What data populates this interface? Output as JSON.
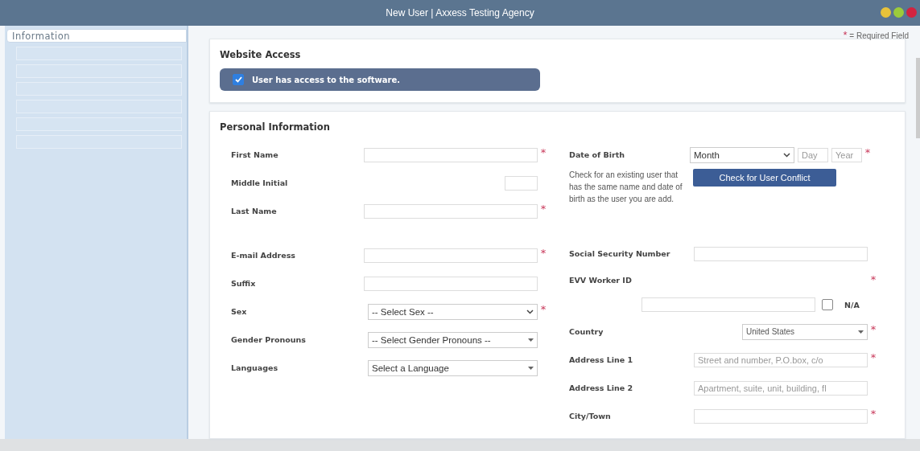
{
  "window": {
    "title": "New User | Axxess Testing Agency"
  },
  "sidebar": {
    "items": [
      {
        "label": "Information",
        "selected": true
      },
      {
        "selected": false
      },
      {
        "selected": false
      },
      {
        "selected": false
      },
      {
        "selected": false
      },
      {
        "selected": false
      },
      {
        "selected": false
      }
    ]
  },
  "required_note": {
    "mark": "*",
    "text": "= Required Field"
  },
  "website_access": {
    "title": "Website Access",
    "checkbox": {
      "label": "User has access to the software.",
      "checked": true
    }
  },
  "personal_information": {
    "title": "Personal Information",
    "left_fields": [
      {
        "kind": "text",
        "label": "First Name",
        "required": true
      },
      {
        "kind": "short",
        "label": "Middle Initial",
        "required": false
      },
      {
        "kind": "text",
        "label": "Last Name",
        "required": true
      },
      {
        "kind": "gap"
      },
      {
        "kind": "text",
        "label": "E-mail Address",
        "required": true
      },
      {
        "kind": "text",
        "label": "Suffix",
        "required": false
      },
      {
        "kind": "select",
        "label": "Sex",
        "value": "-- Select Sex --",
        "required": true
      },
      {
        "kind": "combo",
        "label": "Gender Pronouns",
        "value": "-- Select Gender Pronouns --",
        "required": false
      },
      {
        "kind": "combo",
        "label": "Languages",
        "value": "Select a Language",
        "required": false
      }
    ],
    "right_fields": [
      {
        "kind": "date",
        "label": "Date of Birth",
        "month": "Month",
        "day_placeholder": "Day",
        "year_placeholder": "Year",
        "required": true
      },
      {
        "kind": "conflict",
        "text": "Check for an existing user that has the same name and date of birth as the user you are add.",
        "button": "Check for User Conflict"
      },
      {
        "kind": "text",
        "label": "Social Security Number",
        "required": false
      },
      {
        "kind": "evv",
        "label": "EVV Worker ID",
        "checkbox_label": "N/A",
        "checked": false,
        "required": true
      },
      {
        "kind": "country",
        "label": "Country",
        "value": "United States",
        "required": true
      },
      {
        "kind": "text",
        "label": "Address Line 1",
        "placeholder": "Street and number, P.O.box, c/o",
        "required": true
      },
      {
        "kind": "text",
        "label": "Address Line 2",
        "placeholder": "Apartment, suite, unit, building, fl",
        "required": false
      },
      {
        "kind": "text",
        "label": "City/Town",
        "required": true
      }
    ]
  }
}
